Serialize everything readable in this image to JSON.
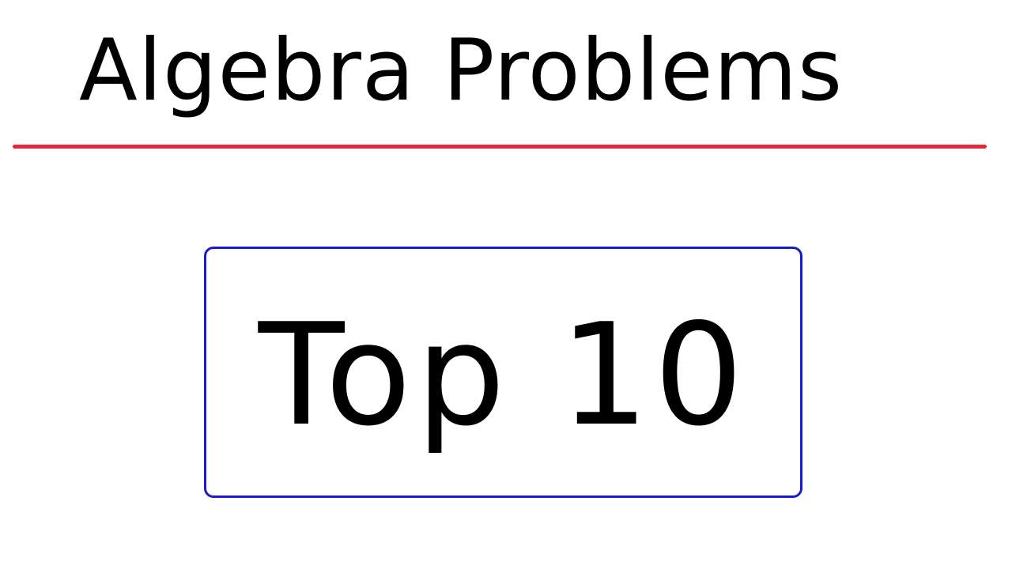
{
  "title": "Algebra Problems",
  "box_label": "Top 10",
  "colors": {
    "divider": "#e0293a",
    "box_border": "#1919d2",
    "text": "#000000",
    "background": "#ffffff"
  }
}
